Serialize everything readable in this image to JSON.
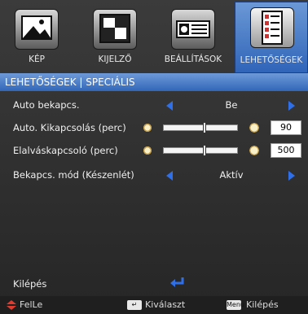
{
  "tabs": [
    {
      "label": "KÉP",
      "icon": "picture-icon"
    },
    {
      "label": "KIJELZŐ",
      "icon": "display-icon"
    },
    {
      "label": "BEÁLLÍTÁSOK",
      "icon": "settings-icon"
    },
    {
      "label": "LEHETŐSÉGEK",
      "icon": "options-icon",
      "active": true
    }
  ],
  "header": {
    "title": "LEHETŐSÉGEK | SPECIÁLIS"
  },
  "rows": [
    {
      "name": "Auto bekapcs.",
      "value": "Be"
    },
    {
      "name": "Auto. Kikapcsolás (perc)",
      "value": "90",
      "level": 0.55
    },
    {
      "name": "Elalváskapcsoló (perc)",
      "value": "500",
      "level": 0.55
    },
    {
      "name": "Bekapcs. mód (Készenlét)",
      "value": "Aktív"
    }
  ],
  "exit": {
    "label": "Kilépés"
  },
  "footer": {
    "updown": "FelLe",
    "select_key": "↵",
    "select": "Kiválaszt",
    "menu_key": "Menu",
    "exit": "Kilépés"
  },
  "colors": {
    "accent": "#2f6fe8",
    "header": "#3166b8",
    "background": "#2c2c2c"
  }
}
